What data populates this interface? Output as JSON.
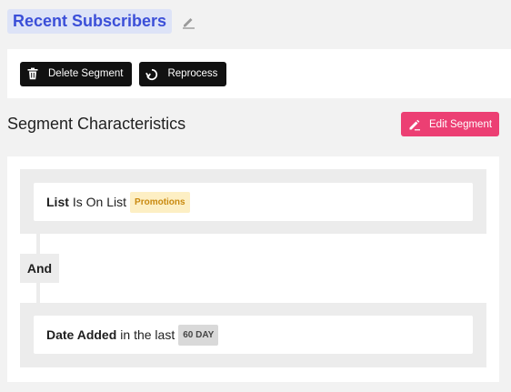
{
  "segment": {
    "title": "Recent Subscribers",
    "title_edit_icon": "pencil-icon"
  },
  "toolbar": {
    "delete_label": "Delete Segment",
    "delete_icon": "trash-icon",
    "reprocess_label": "Reprocess",
    "reprocess_icon": "refresh-icon"
  },
  "characteristics": {
    "heading": "Segment Characteristics",
    "edit_label": "Edit Segment",
    "edit_icon": "pencil-icon",
    "conditions": [
      {
        "field": "List",
        "operator": "Is On List",
        "value": "Promotions"
      },
      {
        "field": "Date Added",
        "operator": "in the last",
        "value": "60 DAY"
      }
    ],
    "joiner": "And"
  },
  "colors": {
    "title_bg": "#dde3f7",
    "title_text": "#3b4fd8",
    "dark_button": "#111111",
    "accent_pink": "#ec3f73",
    "badge_yellow_bg": "#fdefc4",
    "badge_yellow_text": "#c98a10",
    "badge_gray_bg": "#d9d9d9"
  }
}
